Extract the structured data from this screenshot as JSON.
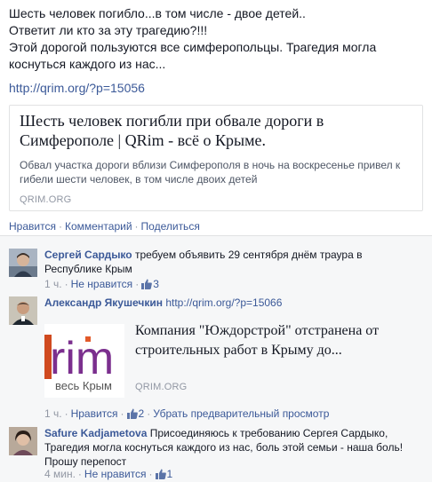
{
  "post": {
    "lines": [
      "Шесть человек погибло...в том числе - двое детей..",
      "Ответит ли кто за эту трагедию?!!!",
      "Этой дорогой пользуются все симферопольцы. Трагедия могла",
      "коснуться каждого из нас..."
    ],
    "link": "http://qrim.org/?p=15056"
  },
  "link_card": {
    "title": "Шесть человек погибли при обвале дороги в Симферополе | QRim - всё о Крыме.",
    "description": "Обвал участка дороги вблизи Симферополя в ночь на воскресенье привел к гибели шести человек, в том числе двоих детей",
    "domain": "QRIM.ORG"
  },
  "actions": {
    "like": "Нравится",
    "comment": "Комментарий",
    "share": "Поделиться",
    "separator": "·"
  },
  "comments": [
    {
      "author": "Сергей Сардыко",
      "text": "требуем объявить 29 сентября днём траура в Республике Крым",
      "time": "1 ч.",
      "like_action": "Не нравится",
      "like_count": "3"
    },
    {
      "author": "Александр Якушечкин",
      "text": "http://qrim.org/?p=15066",
      "attachment": {
        "title": "Компания \"Юждорстрой\" отстранена от строительных работ в Крыму до...",
        "domain": "QRIM.ORG",
        "logo_text": "весь Крым"
      },
      "time": "1 ч.",
      "like_action": "Нравится",
      "like_count": "2",
      "remove_preview": "Убрать предварительный просмотр"
    },
    {
      "author": "Safure Kadjametova",
      "text": "Присоединяюсь к требованию Сергея Сардыко, Трагедия могла коснуться каждого из нас, боль этой семьи - наша боль! Прошу перепост",
      "time": "4 мин.",
      "like_action": "Не нравится",
      "like_count": "1"
    }
  ],
  "colors": {
    "link": "#3b5998",
    "meta": "#9197a3",
    "comments_bg": "#f6f7f8",
    "brand_purple": "#7b2f8e"
  },
  "icons": [
    "thumbs-up-icon"
  ]
}
